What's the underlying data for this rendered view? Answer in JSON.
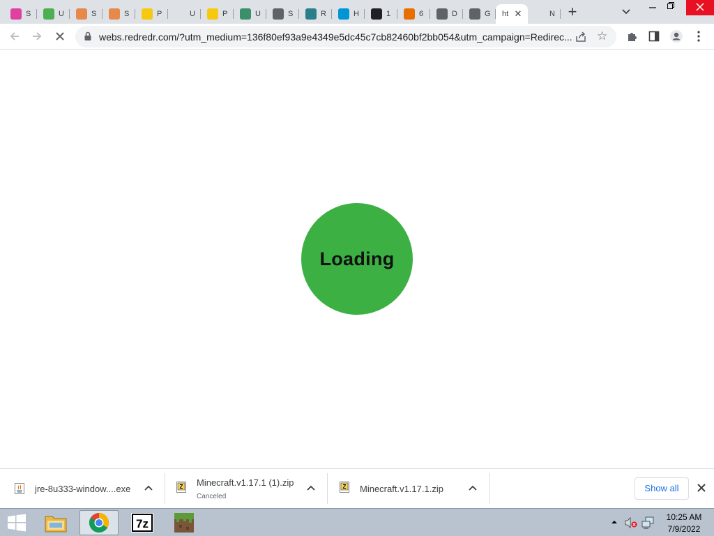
{
  "browser": {
    "tabs": [
      {
        "title": "S",
        "icon": "pink-logo-icon",
        "color": "#e040a0"
      },
      {
        "title": "U",
        "icon": "green-cloud-icon",
        "color": "#4caf50"
      },
      {
        "title": "S",
        "icon": "person-icon",
        "color": "#e6894b"
      },
      {
        "title": "S",
        "icon": "person-icon",
        "color": "#e6894b"
      },
      {
        "title": "P",
        "icon": "yellow-smile-icon",
        "color": "#f6c90e"
      },
      {
        "title": "U",
        "icon": "blank-icon",
        "color": "#dee1e6"
      },
      {
        "title": "P",
        "icon": "yellow-smile-icon",
        "color": "#f6c90e"
      },
      {
        "title": "U",
        "icon": "green-logo-icon",
        "color": "#3b8f6a"
      },
      {
        "title": "S",
        "icon": "globe-icon",
        "color": "#5f6368"
      },
      {
        "title": "R",
        "icon": "re-logo-icon",
        "color": "#2a7f8a"
      },
      {
        "title": "H",
        "icon": "hp-logo-icon",
        "color": "#0096d6"
      },
      {
        "title": "1",
        "icon": "ten-logo-icon",
        "color": "#202124"
      },
      {
        "title": "6",
        "icon": "java-icon",
        "color": "#e76f00"
      },
      {
        "title": "D",
        "icon": "box-icon",
        "color": "#5f6368"
      },
      {
        "title": "G",
        "icon": "globe-icon",
        "color": "#5f6368"
      },
      {
        "title": "ht",
        "icon": "none",
        "color": "#ffffff",
        "active": true
      },
      {
        "title": "N",
        "icon": "blank-icon",
        "color": "#dee1e6"
      }
    ],
    "new_tab_label": "+",
    "url": "webs.redredr.com/?utm_medium=136f80ef93a9e4349e5dc45c7cb82460bf2bb054&utm_campaign=Redirec..."
  },
  "page": {
    "loading_text": "Loading",
    "loader_color": "#3cb043"
  },
  "downloads": {
    "items": [
      {
        "name": "jre-8u333-window....exe",
        "status": "",
        "icon": "java-file-icon"
      },
      {
        "name": "Minecraft.v1.17.1 (1).zip",
        "status": "Canceled",
        "icon": "zip-file-icon"
      },
      {
        "name": "Minecraft.v1.17.1.zip",
        "status": "",
        "icon": "zip-file-icon"
      }
    ],
    "show_all_label": "Show all"
  },
  "taskbar": {
    "apps": [
      "start-icon",
      "file-explorer-icon",
      "chrome-icon",
      "7zip-icon",
      "minecraft-icon"
    ],
    "time": "10:25 AM",
    "date": "7/9/2022"
  }
}
